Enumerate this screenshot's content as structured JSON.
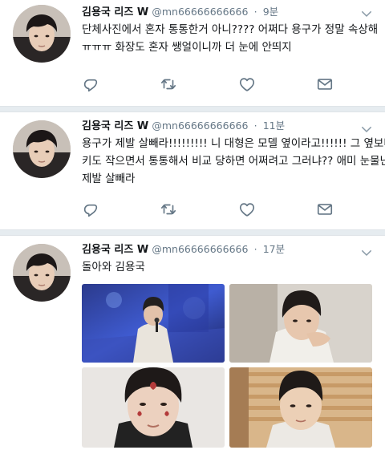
{
  "tweets": [
    {
      "name": "김용국 리즈 W",
      "handle": "@mn66666666666",
      "dot": "·",
      "time": "9분",
      "lines": [
        "단체사진에서 혼자 통통한거 아니???? 어쩌다 용구가 정말 속상해",
        "ㅠㅠㅠ 화장도 혼자 쌩얼이니까 더 눈에 안띄지"
      ]
    },
    {
      "name": "김용국 리즈 W",
      "handle": "@mn66666666666",
      "dot": "·",
      "time": "11분",
      "lines": [
        "용구가 제발 살빼라!!!!!!!!! 니 대형은 모델 옆이라고!!!!!! 그 옆보다",
        "키도 작으면서 통통해서 비교 당하면 어쩌려고 그러냐?? 애미 눈물난다",
        "제발 살빼라"
      ]
    },
    {
      "name": "김용국 리즈 W",
      "handle": "@mn66666666666",
      "dot": "·",
      "time": "17분",
      "lines": [
        "돌아와 김용국"
      ]
    }
  ],
  "icons": {
    "reply": "reply-icon",
    "retweet": "retweet-icon",
    "like": "heart-icon",
    "message": "envelope-icon",
    "caret": "chevron-down-icon"
  },
  "colors": {
    "icon": "#657786",
    "text": "#14171a",
    "muted": "#657786",
    "divider": "#e6ecf0"
  }
}
